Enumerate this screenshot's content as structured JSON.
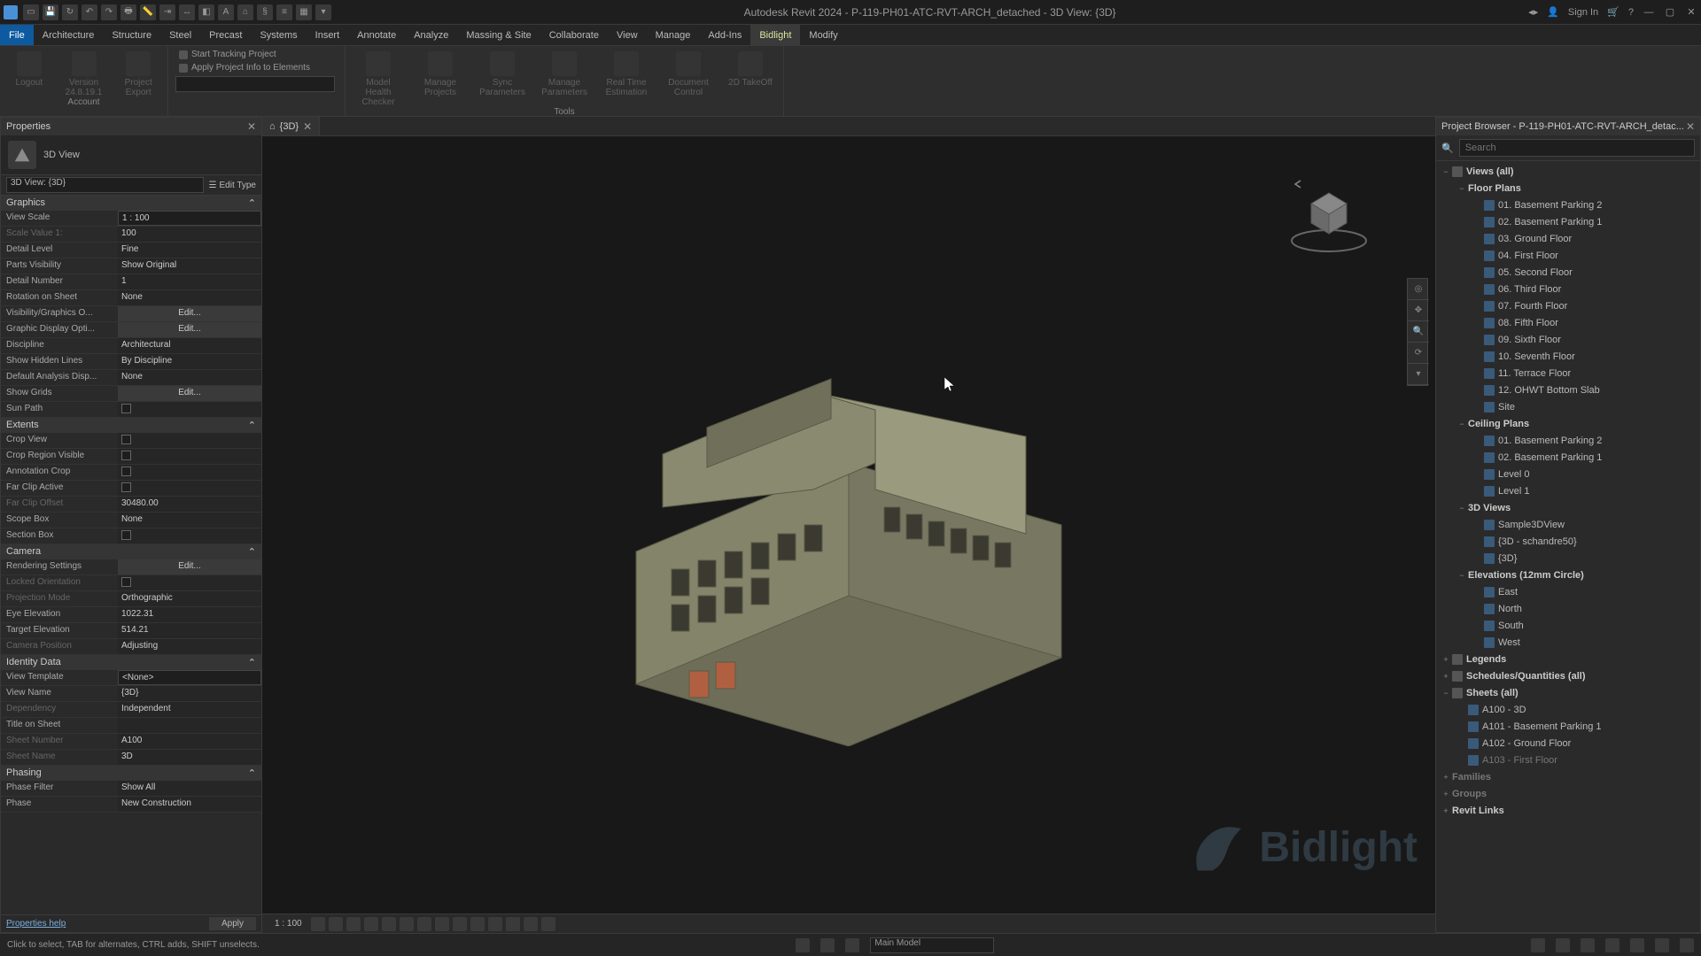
{
  "title": "Autodesk Revit 2024 - P-119-PH01-ATC-RVT-ARCH_detached - 3D View: {3D}",
  "signin": "Sign In",
  "menu": [
    "File",
    "Architecture",
    "Structure",
    "Steel",
    "Precast",
    "Systems",
    "Insert",
    "Annotate",
    "Analyze",
    "Massing & Site",
    "Collaborate",
    "View",
    "Manage",
    "Add-Ins",
    "Bidlight",
    "Modify"
  ],
  "ribbon": {
    "account_tools": [
      {
        "label": "Logout"
      },
      {
        "label": "Version 24.8.19.1"
      },
      {
        "label": "Project Export"
      }
    ],
    "text_buttons": [
      "Start Tracking Project",
      "Apply Project Info to Elements"
    ],
    "tool_buttons": [
      {
        "label": "Model Health Checker"
      },
      {
        "label": "Manage Projects"
      },
      {
        "label": "Sync Parameters"
      },
      {
        "label": "Manage Parameters"
      },
      {
        "label": "Real Time Estimation"
      },
      {
        "label": "Document Control"
      },
      {
        "label": "2D TakeOff"
      }
    ],
    "panel_labels": {
      "account": "Account",
      "tools": "Tools"
    }
  },
  "view_tab": "{3D}",
  "properties": {
    "title": "Properties",
    "view_type": "3D View",
    "selector": "3D View: {3D}",
    "edit_type": "Edit Type",
    "sections": {
      "graphics": {
        "title": "Graphics",
        "rows": [
          {
            "k": "View Scale",
            "v": "1 : 100",
            "type": "editbox"
          },
          {
            "k": "Scale Value   1:",
            "v": "100",
            "dim": true
          },
          {
            "k": "Detail Level",
            "v": "Fine"
          },
          {
            "k": "Parts Visibility",
            "v": "Show Original"
          },
          {
            "k": "Detail Number",
            "v": "1"
          },
          {
            "k": "Rotation on Sheet",
            "v": "None"
          },
          {
            "k": "Visibility/Graphics O...",
            "v": "Edit...",
            "type": "btn"
          },
          {
            "k": "Graphic Display Opti...",
            "v": "Edit...",
            "type": "btn"
          },
          {
            "k": "Discipline",
            "v": "Architectural"
          },
          {
            "k": "Show Hidden Lines",
            "v": "By Discipline"
          },
          {
            "k": "Default Analysis Disp...",
            "v": "None"
          },
          {
            "k": "Show Grids",
            "v": "Edit...",
            "type": "btn"
          },
          {
            "k": "Sun Path",
            "v": "",
            "type": "cb"
          }
        ]
      },
      "extents": {
        "title": "Extents",
        "rows": [
          {
            "k": "Crop View",
            "v": "",
            "type": "cb"
          },
          {
            "k": "Crop Region Visible",
            "v": "",
            "type": "cb"
          },
          {
            "k": "Annotation Crop",
            "v": "",
            "type": "cb"
          },
          {
            "k": "Far Clip Active",
            "v": "",
            "type": "cb"
          },
          {
            "k": "Far Clip Offset",
            "v": "30480.00",
            "dim": true
          },
          {
            "k": "Scope Box",
            "v": "None"
          },
          {
            "k": "Section Box",
            "v": "",
            "type": "cb"
          }
        ]
      },
      "camera": {
        "title": "Camera",
        "rows": [
          {
            "k": "Rendering Settings",
            "v": "Edit...",
            "type": "btn"
          },
          {
            "k": "Locked Orientation",
            "v": "",
            "type": "cb",
            "dim": true
          },
          {
            "k": "Projection Mode",
            "v": "Orthographic",
            "dim": true
          },
          {
            "k": "Eye Elevation",
            "v": "1022.31"
          },
          {
            "k": "Target Elevation",
            "v": "514.21"
          },
          {
            "k": "Camera Position",
            "v": "Adjusting",
            "dim": true
          }
        ]
      },
      "identity": {
        "title": "Identity Data",
        "rows": [
          {
            "k": "View Template",
            "v": "<None>",
            "type": "editbox"
          },
          {
            "k": "View Name",
            "v": "{3D}"
          },
          {
            "k": "Dependency",
            "v": "Independent",
            "dim": true
          },
          {
            "k": "Title on Sheet",
            "v": ""
          },
          {
            "k": "Sheet Number",
            "v": "A100",
            "dim": true
          },
          {
            "k": "Sheet Name",
            "v": "3D",
            "dim": true
          }
        ]
      },
      "phasing": {
        "title": "Phasing",
        "rows": [
          {
            "k": "Phase Filter",
            "v": "Show All"
          },
          {
            "k": "Phase",
            "v": "New Construction"
          }
        ]
      }
    },
    "help": "Properties help",
    "apply": "Apply"
  },
  "viewctrl_scale": "1 : 100",
  "browser": {
    "title": "Project Browser - P-119-PH01-ATC-RVT-ARCH_detac...",
    "search_ph": "Search",
    "tree": [
      {
        "d": 0,
        "tw": "−",
        "label": "Views (all)",
        "icon": "root",
        "bold": true
      },
      {
        "d": 1,
        "tw": "−",
        "label": "Floor Plans",
        "bold": true
      },
      {
        "d": 2,
        "tw": "",
        "label": "01. Basement Parking 2",
        "icon": "sheet"
      },
      {
        "d": 2,
        "tw": "",
        "label": "02. Basement Parking 1",
        "icon": "sheet"
      },
      {
        "d": 2,
        "tw": "",
        "label": "03. Ground Floor",
        "icon": "sheet"
      },
      {
        "d": 2,
        "tw": "",
        "label": "04. First Floor",
        "icon": "sheet"
      },
      {
        "d": 2,
        "tw": "",
        "label": "05. Second Floor",
        "icon": "sheet"
      },
      {
        "d": 2,
        "tw": "",
        "label": "06. Third Floor",
        "icon": "sheet"
      },
      {
        "d": 2,
        "tw": "",
        "label": "07. Fourth Floor",
        "icon": "sheet"
      },
      {
        "d": 2,
        "tw": "",
        "label": "08. Fifth Floor",
        "icon": "sheet"
      },
      {
        "d": 2,
        "tw": "",
        "label": "09. Sixth Floor",
        "icon": "sheet"
      },
      {
        "d": 2,
        "tw": "",
        "label": "10. Seventh Floor",
        "icon": "sheet"
      },
      {
        "d": 2,
        "tw": "",
        "label": "11. Terrace Floor",
        "icon": "sheet"
      },
      {
        "d": 2,
        "tw": "",
        "label": "12. OHWT Bottom Slab",
        "icon": "sheet"
      },
      {
        "d": 2,
        "tw": "",
        "label": "Site",
        "icon": "sheet"
      },
      {
        "d": 1,
        "tw": "−",
        "label": "Ceiling Plans",
        "bold": true
      },
      {
        "d": 2,
        "tw": "",
        "label": "01. Basement Parking 2",
        "icon": "sheet"
      },
      {
        "d": 2,
        "tw": "",
        "label": "02. Basement Parking 1",
        "icon": "sheet"
      },
      {
        "d": 2,
        "tw": "",
        "label": "Level 0",
        "icon": "sheet"
      },
      {
        "d": 2,
        "tw": "",
        "label": "Level 1",
        "icon": "sheet"
      },
      {
        "d": 1,
        "tw": "−",
        "label": "3D Views",
        "bold": true
      },
      {
        "d": 2,
        "tw": "",
        "label": "Sample3DView",
        "icon": "sheet"
      },
      {
        "d": 2,
        "tw": "",
        "label": "{3D - schandre50}",
        "icon": "sheet"
      },
      {
        "d": 2,
        "tw": "",
        "label": "{3D}",
        "icon": "sheet"
      },
      {
        "d": 1,
        "tw": "−",
        "label": "Elevations (12mm Circle)",
        "bold": true
      },
      {
        "d": 2,
        "tw": "",
        "label": "East",
        "icon": "sheet"
      },
      {
        "d": 2,
        "tw": "",
        "label": "North",
        "icon": "sheet"
      },
      {
        "d": 2,
        "tw": "",
        "label": "South",
        "icon": "sheet"
      },
      {
        "d": 2,
        "tw": "",
        "label": "West",
        "icon": "sheet"
      },
      {
        "d": 0,
        "tw": "+",
        "label": "Legends",
        "icon": "root",
        "bold": true
      },
      {
        "d": 0,
        "tw": "+",
        "label": "Schedules/Quantities (all)",
        "icon": "root",
        "bold": true
      },
      {
        "d": 0,
        "tw": "−",
        "label": "Sheets (all)",
        "icon": "root",
        "bold": true
      },
      {
        "d": 1,
        "tw": "",
        "label": "A100 - 3D",
        "icon": "sheet"
      },
      {
        "d": 1,
        "tw": "",
        "label": "A101 - Basement Parking 1",
        "icon": "sheet"
      },
      {
        "d": 1,
        "tw": "",
        "label": "A102 - Ground Floor",
        "icon": "sheet"
      },
      {
        "d": 1,
        "tw": "",
        "label": "A103 - First Floor",
        "icon": "sheet",
        "dim": true
      },
      {
        "d": 0,
        "tw": "+",
        "label": "Families",
        "bold": true,
        "dim": true
      },
      {
        "d": 0,
        "tw": "+",
        "label": "Groups",
        "bold": true,
        "dim": true
      },
      {
        "d": 0,
        "tw": "+",
        "label": "Revit Links",
        "bold": true
      }
    ]
  },
  "status_hint": "Click to select, TAB for alternates, CTRL adds, SHIFT unselects.",
  "workset": "Main Model",
  "watermark": "Bidlight"
}
